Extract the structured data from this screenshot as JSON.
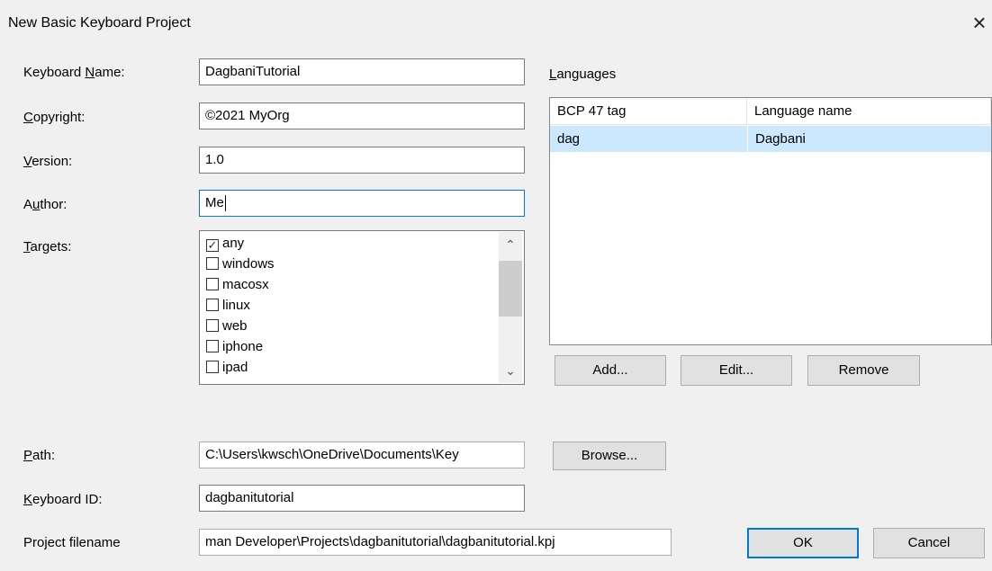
{
  "window": {
    "title": "New Basic Keyboard Project",
    "close_glyph": "×"
  },
  "form": {
    "keyboard_name": {
      "label_pre": "Keyboard ",
      "label_key": "N",
      "label_post": "ame:",
      "value": "DagbaniTutorial"
    },
    "copyright": {
      "label_pre": "",
      "label_key": "C",
      "label_post": "opyright:",
      "value": "©2021 MyOrg"
    },
    "version": {
      "label_pre": "",
      "label_key": "V",
      "label_post": "ersion:",
      "value": "1.0"
    },
    "author": {
      "label_pre": "A",
      "label_key": "u",
      "label_post": "thor:",
      "value": "Me"
    },
    "targets": {
      "label_pre": "",
      "label_key": "T",
      "label_post": "argets:",
      "items": [
        {
          "name": "any",
          "checked": true
        },
        {
          "name": "windows",
          "checked": false
        },
        {
          "name": "macosx",
          "checked": false
        },
        {
          "name": "linux",
          "checked": false
        },
        {
          "name": "web",
          "checked": false
        },
        {
          "name": "iphone",
          "checked": false
        },
        {
          "name": "ipad",
          "checked": false
        }
      ]
    },
    "path": {
      "label_pre": "",
      "label_key": "P",
      "label_post": "ath:",
      "value": "C:\\Users\\kwsch\\OneDrive\\Documents\\Key"
    },
    "keyboard_id": {
      "label_pre": "",
      "label_key": "K",
      "label_post": "eyboard ID:",
      "value": "dagbanitutorial"
    },
    "project_filename": {
      "label": "Project filename",
      "value": "man Developer\\Projects\\dagbanitutorial\\dagbanitutorial.kpj"
    }
  },
  "languages": {
    "label_pre": "",
    "label_key": "L",
    "label_post": "anguages",
    "columns": [
      "BCP 47 tag",
      "Language name"
    ],
    "rows": [
      {
        "tag": "dag",
        "name": "Dagbani"
      }
    ]
  },
  "buttons": {
    "add": "Add...",
    "edit": "Edit...",
    "remove": "Remove",
    "browse": "Browse...",
    "ok": "OK",
    "cancel": "Cancel"
  },
  "icons": {
    "scroll_up": "chevron-up-icon",
    "scroll_down": "chevron-down-icon",
    "check": "checkmark-icon"
  }
}
